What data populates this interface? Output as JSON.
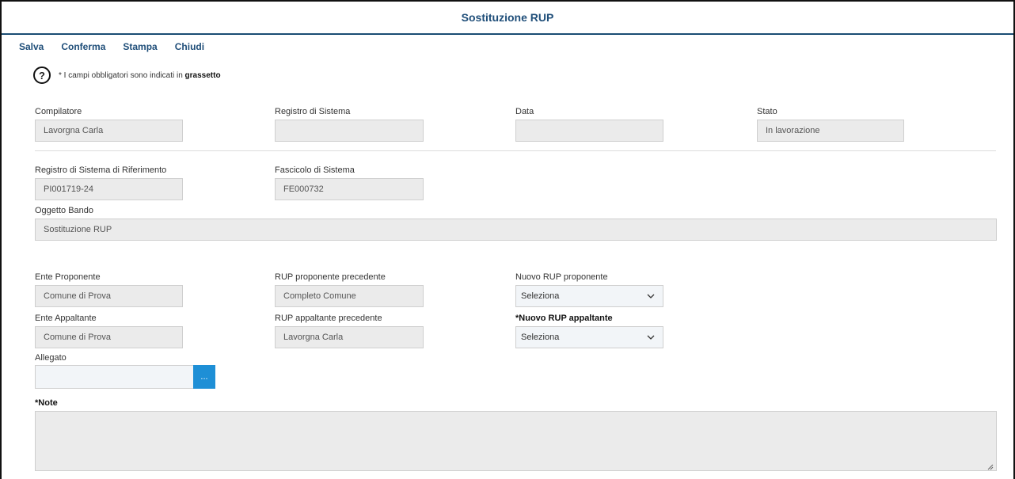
{
  "window": {
    "title": "Sostituzione RUP"
  },
  "toolbar": {
    "save": "Salva",
    "confirm": "Conferma",
    "print": "Stampa",
    "close": "Chiudi"
  },
  "help": {
    "icon": "question-circle-icon",
    "text": "* I campi obbligatori sono indicati in",
    "bold": "grassetto"
  },
  "fields": {
    "compilatore": {
      "label": "Compilatore",
      "value": "Lavorgna Carla"
    },
    "registro": {
      "label": "Registro di Sistema",
      "value": ""
    },
    "data": {
      "label": "Data",
      "value": ""
    },
    "stato": {
      "label": "Stato",
      "value": "In lavorazione"
    },
    "registro_rif": {
      "label": "Registro di Sistema di Riferimento",
      "value": "PI001719-24"
    },
    "fascicolo": {
      "label": "Fascicolo di Sistema",
      "value": "FE000732"
    },
    "oggetto": {
      "label": "Oggetto Bando",
      "value": "Sostituzione RUP"
    },
    "ente_proponente": {
      "label": "Ente Proponente",
      "value": "Comune di Prova"
    },
    "rup_prop_prec": {
      "label": "RUP proponente precedente",
      "value": "Completo Comune"
    },
    "nuovo_rup_prop": {
      "label": "Nuovo RUP proponente",
      "value": "Seleziona"
    },
    "ente_appaltante": {
      "label": "Ente Appaltante",
      "value": "Comune di Prova"
    },
    "rup_app_prec": {
      "label": "RUP appaltante precedente",
      "value": "Lavorgna Carla"
    },
    "nuovo_rup_app": {
      "label": "*Nuovo RUP appaltante",
      "value": "Seleziona"
    },
    "allegato": {
      "label": "Allegato",
      "button": "..."
    },
    "note": {
      "label": "*Note",
      "value": ""
    }
  },
  "colors": {
    "accent": "#1f4e79",
    "button": "#1e8fd6",
    "field_bg": "#ebebeb"
  }
}
